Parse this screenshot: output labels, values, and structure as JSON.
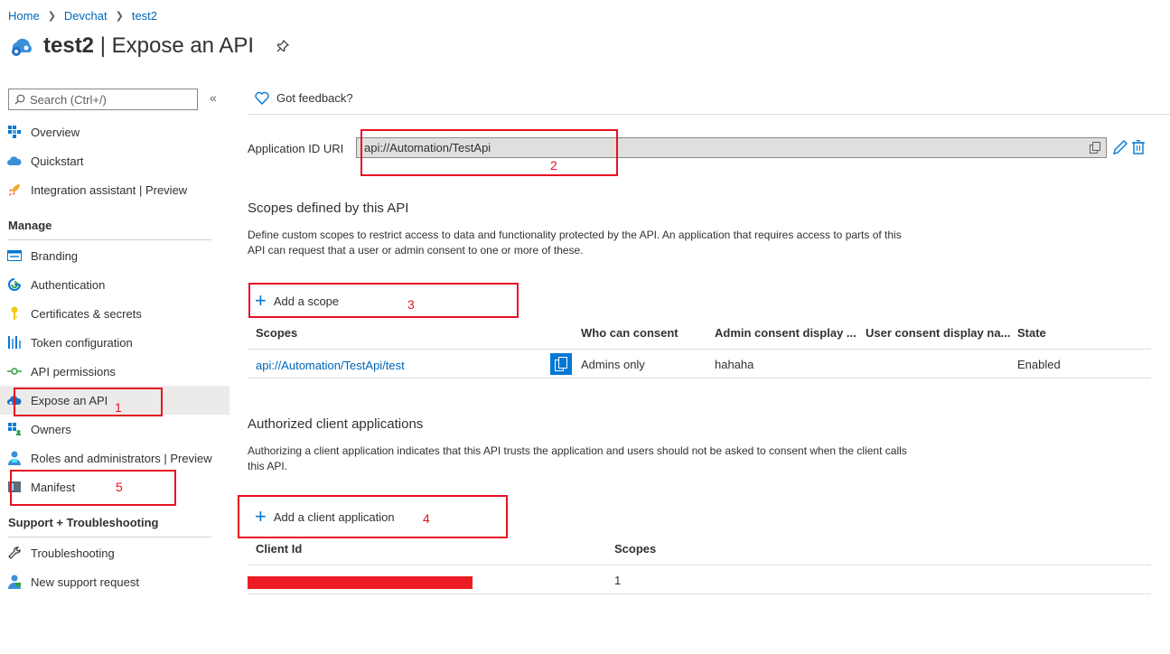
{
  "breadcrumb": {
    "home": "Home",
    "devchat": "Devchat",
    "app": "test2"
  },
  "header": {
    "app_name": "test2",
    "separator": "|",
    "page": "Expose an API"
  },
  "sidebar": {
    "search_placeholder": "Search (Ctrl+/)",
    "collapse": "«",
    "items": [
      {
        "label": "Overview"
      },
      {
        "label": "Quickstart"
      },
      {
        "label": "Integration assistant | Preview"
      }
    ],
    "manage_header": "Manage",
    "manage_items": [
      {
        "label": "Branding"
      },
      {
        "label": "Authentication"
      },
      {
        "label": "Certificates & secrets"
      },
      {
        "label": "Token configuration"
      },
      {
        "label": "API permissions"
      },
      {
        "label": "Expose an API"
      },
      {
        "label": "Owners"
      },
      {
        "label": "Roles and administrators | Preview"
      },
      {
        "label": "Manifest"
      }
    ],
    "support_header": "Support + Troubleshooting",
    "support_items": [
      {
        "label": "Troubleshooting"
      },
      {
        "label": "New support request"
      }
    ]
  },
  "main": {
    "feedback": "Got feedback?",
    "app_id_label": "Application ID URI",
    "app_id_value": "api://Automation/TestApi",
    "scopes_title": "Scopes defined by this API",
    "scopes_desc_line1": "Define custom scopes to restrict access to data and functionality protected by the API. An application that requires access to parts of this",
    "scopes_desc_line2": "API can request that a user or admin consent to one or more of these.",
    "add_scope": "Add a scope",
    "scope_columns": [
      "Scopes",
      "Who can consent",
      "Admin consent display ...",
      "User consent display na...",
      "State"
    ],
    "scope_row": {
      "scope": "api://Automation/TestApi/test",
      "who": "Admins only",
      "admin_display": "hahaha",
      "user_display": "",
      "state": "Enabled"
    },
    "clients_title": "Authorized client applications",
    "clients_desc_line1": "Authorizing a client application indicates that this API trusts the application and users should not be asked to consent when the client calls",
    "clients_desc_line2": "this API.",
    "add_client": "Add a client application",
    "client_columns": [
      "Client Id",
      "Scopes"
    ],
    "client_row": {
      "scopes": "1"
    }
  },
  "annotations": [
    "1",
    "2",
    "3",
    "4",
    "5"
  ],
  "colors": {
    "accent": "#0078d4",
    "link": "#0067b8",
    "annotation": "#e81123"
  }
}
